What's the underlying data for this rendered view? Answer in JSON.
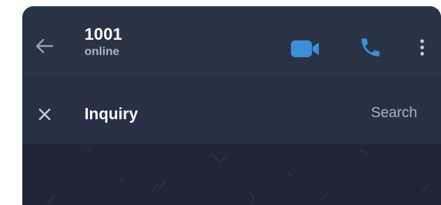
{
  "header": {
    "title": "1001",
    "status": "online",
    "back_icon": "arrow-left-icon",
    "video_icon": "video-camera-icon",
    "call_icon": "phone-icon",
    "more_icon": "more-vertical-icon"
  },
  "search": {
    "close_icon": "close-icon",
    "query": "Inquiry",
    "button_label": "Search"
  },
  "colors": {
    "header_bg": "#2a3346",
    "search_bg": "#273044",
    "chat_bg": "#1d2536",
    "accent": "#3d8fd6",
    "text_primary": "#ffffff",
    "text_secondary": "#aab3c2"
  }
}
